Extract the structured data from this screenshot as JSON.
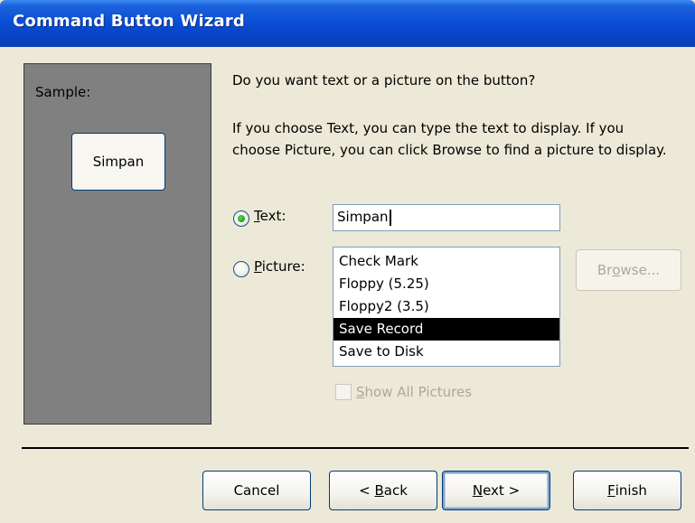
{
  "window": {
    "title": "Command Button Wizard"
  },
  "sample": {
    "label": "Sample:",
    "button_text": "Simpan"
  },
  "prompt": {
    "question": "Do you want text or a picture on the button?",
    "explain_line1": "If you choose Text, you can type the text to display.  If you",
    "explain_line2": "choose Picture, you can click Browse to find a picture to display."
  },
  "options": {
    "text": {
      "mnemonic": "T",
      "rest": "ext:",
      "selected": true
    },
    "picture": {
      "mnemonic": "P",
      "rest": "icture:",
      "selected": false
    }
  },
  "text_field": {
    "value": "Simpan"
  },
  "picture_list": {
    "items": [
      "Check Mark",
      "Floppy (5.25)",
      "Floppy2 (3.5)",
      "Save Record",
      "Save to Disk"
    ],
    "selected": "Save Record"
  },
  "browse": {
    "pre": "Br",
    "mnemonic": "o",
    "post": "wse..."
  },
  "show_all": {
    "mnemonic": "S",
    "rest": "how All Pictures",
    "checked": false
  },
  "buttons": {
    "cancel": "Cancel",
    "back": {
      "pre": "< ",
      "mnemonic": "B",
      "post": "ack"
    },
    "next": {
      "mnemonic": "N",
      "post": "ext >"
    },
    "finish": {
      "mnemonic": "F",
      "post": "inish"
    }
  },
  "colors": {
    "title_bar": "#0a4fd6",
    "dialog_bg": "#ece9d8",
    "sample_bg": "#808080",
    "selection": "#000000",
    "radio_dot": "#21a121"
  }
}
